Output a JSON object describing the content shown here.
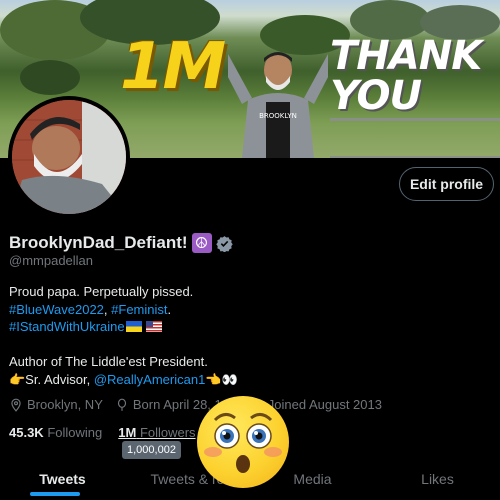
{
  "banner": {
    "big_text": "1M",
    "thank_line1": "THANK",
    "thank_line2": "YOU",
    "shirt_text": "BROOKLYN"
  },
  "profile": {
    "edit_label": "Edit profile",
    "display_name": "BrooklynDad_Defiant!",
    "name_emoji": "☮",
    "handle": "@mmpadellan",
    "bio_line1": "Proud papa. Perpetually pissed.",
    "bio_tag1": "#BlueWave2022",
    "bio_sep": ", ",
    "bio_tag2": "#Feminist",
    "bio_dot": ".",
    "bio_tag3": "#IStandWithUkraine",
    "bio_line4": "Author of The Liddle'est President.",
    "bio_pre5": "👉Sr. Advisor, ",
    "bio_link5": "@ReallyAmerican1",
    "bio_post5": "👈👀",
    "location": "Brooklyn, NY",
    "born": "Born April 28, 1",
    "joined": "Joined August 2013",
    "following_count": "45.3K",
    "following_label": "Following",
    "followers_count": "1M",
    "followers_label": "Followers",
    "followers_tooltip": "1,000,002"
  },
  "tabs": [
    "Tweets",
    "Tweets & re",
    "Media",
    "Likes"
  ],
  "colors": {
    "accent": "#1d9bf0",
    "muted": "#71767b",
    "yellow": "#f6d21a"
  },
  "icons": {
    "location": "location-pin-icon",
    "birthday": "balloon-icon",
    "joined": "calendar-icon",
    "verified": "verified-badge-icon",
    "emoji": "flushed-face-icon"
  }
}
